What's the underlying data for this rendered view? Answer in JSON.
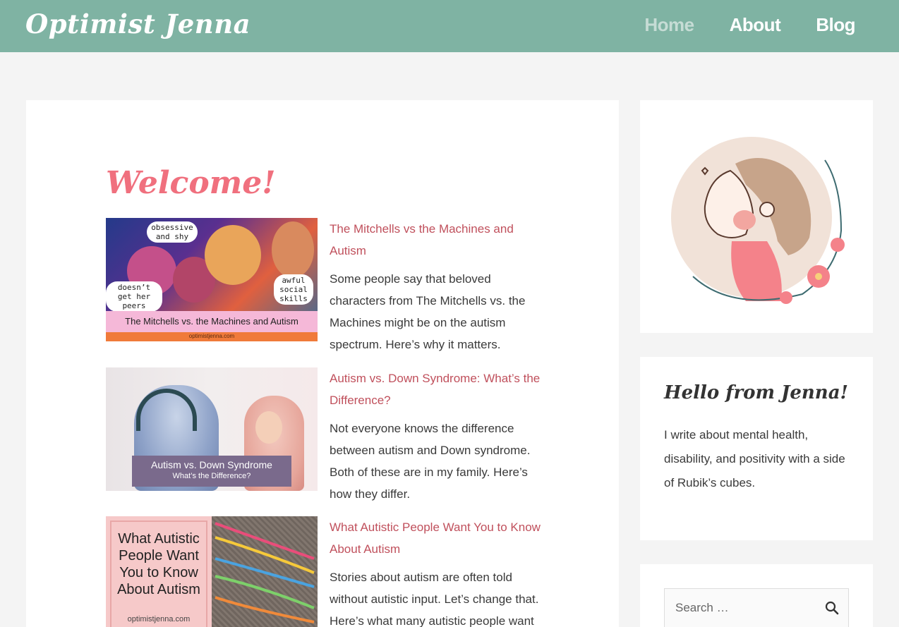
{
  "header": {
    "site_title": "Optimist Jenna",
    "nav": [
      "Home",
      "About",
      "Blog"
    ],
    "colors": {
      "bar": "#7fb3a3",
      "current_nav": "#c6dcd5"
    }
  },
  "main": {
    "heading": "Welcome!",
    "posts": [
      {
        "title": "The Mitchells vs the Machines and Autism",
        "excerpt": "Some people say that beloved characters from The Mitchells vs. the Machines might be on the autism spectrum. Here’s why it matters.",
        "image": {
          "bubble_1": "obsessive and shy",
          "bubble_2": "doesn’t get her peers",
          "bubble_3": "awful social skills",
          "caption": "The Mitchells vs. the Machines and Autism",
          "domain": "optimistjenna.com"
        }
      },
      {
        "title": "Autism vs. Down Syndrome: What’s the Difference?",
        "excerpt": "Not everyone knows the difference between autism and Down syndrome. Both of these are in my family. Here’s how they differ.",
        "image": {
          "caption_line_1": "Autism vs. Down Syndrome",
          "caption_line_2": "What’s the Difference?"
        }
      },
      {
        "title": "What Autistic People Want You to Know About Autism",
        "excerpt": "Stories about autism are often told without autistic input. Let’s change that. Here’s what many autistic people want",
        "image": {
          "headline": "What Autistic People Want You to Know About Autism",
          "domain": "optimistjenna.com"
        }
      }
    ],
    "colors": {
      "heading": "#f0707e",
      "post_title": "#c0505c"
    }
  },
  "sidebar": {
    "hello_title": "Hello from Jenna!",
    "hello_text": "I write about mental health, disability, and positivity with a side of Rubik’s cubes.",
    "search": {
      "placeholder": "Search …",
      "icon": "search-icon"
    }
  }
}
